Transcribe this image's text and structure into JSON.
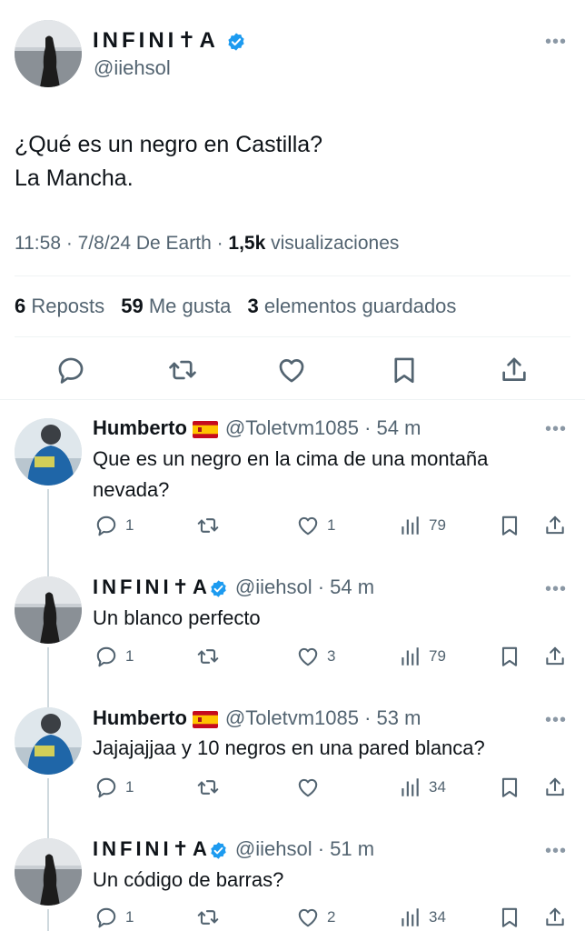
{
  "main_tweet": {
    "author_name": "INFINI✝A",
    "author_handle": "@iiehsol",
    "text_line1": "¿Qué es un negro en Castilla?",
    "text_line2": "La Mancha.",
    "time": "11:58 · 7/8/24 De Earth · ",
    "views_count": "1,5k",
    "views_label": " visualizaciones",
    "reposts_count": "6",
    "reposts_label": "Reposts",
    "likes_count": "59",
    "likes_label": "Me gusta",
    "saved_count": "3",
    "saved_label": "elementos guardados",
    "icons": [
      "reply-icon",
      "repost-icon",
      "like-icon",
      "bookmark-icon",
      "share-icon"
    ]
  },
  "replies": [
    {
      "name": "Humberto",
      "flag": "spain-flag",
      "handle": "@Toletvm1085",
      "time": " · 54 m",
      "text": "Que es un negro en la cima de una montaña nevada?",
      "replies": "1",
      "reposts": "",
      "likes": "1",
      "views": "79"
    },
    {
      "name": "INFINI✝A",
      "flag": "",
      "handle": "@iiehsol",
      "time": " · 54 m",
      "text": "Un blanco perfecto",
      "replies": "1",
      "reposts": "",
      "likes": "3",
      "views": "79"
    },
    {
      "name": "Humberto",
      "flag": "spain-flag",
      "handle": "@Toletvm1085",
      "time": " · 53 m",
      "text": "Jajajajjaa y 10 negros en una pared blanca?",
      "replies": "1",
      "reposts": "",
      "likes": "",
      "views": "34"
    },
    {
      "name": "INFINI✝A",
      "flag": "",
      "handle": "@iiehsol",
      "time": " · 51 m",
      "text": "Un código de barras?",
      "replies": "1",
      "reposts": "",
      "likes": "2",
      "views": "34"
    }
  ],
  "colors": {
    "verified": "#1d9bf0",
    "secondary_text": "#536471",
    "divider": "#eff3f4"
  }
}
